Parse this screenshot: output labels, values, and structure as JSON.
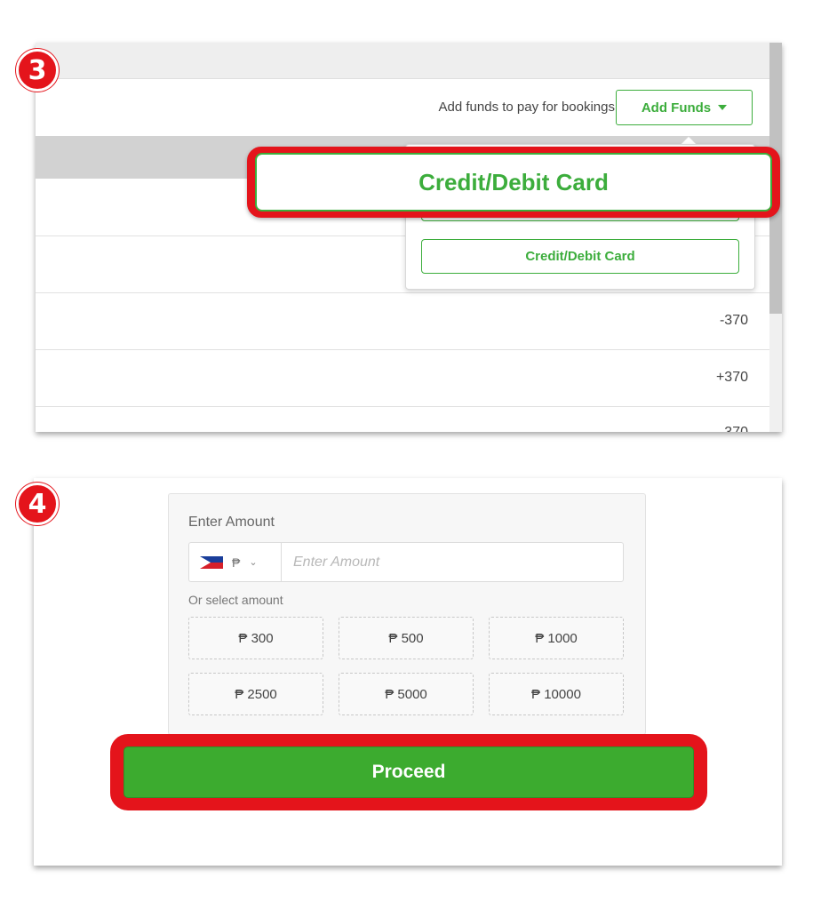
{
  "steps": {
    "step3": "3",
    "step4": "4"
  },
  "funds_panel": {
    "helper_text": "Add funds to pay for bookings",
    "add_funds_label": "Add Funds",
    "dropdown_options": [
      "",
      "Credit/Debit Card"
    ],
    "zoom_option_label": "Credit/Debit Card",
    "transactions": [
      "",
      "",
      "-370",
      "+370",
      "-370"
    ]
  },
  "amount_form": {
    "label": "Enter Amount",
    "currency_symbol": "₱",
    "country_flag": "philippines-flag",
    "input_placeholder": "Enter Amount",
    "or_select_label": "Or select amount",
    "presets": [
      "₱ 300",
      "₱ 500",
      "₱ 1000",
      "₱ 2500",
      "₱ 5000",
      "₱ 10000"
    ],
    "proceed_label": "Proceed"
  },
  "colors": {
    "accent_green": "#3cad3c",
    "proceed_green": "#3cab2f",
    "highlight_red": "#e4141b"
  }
}
